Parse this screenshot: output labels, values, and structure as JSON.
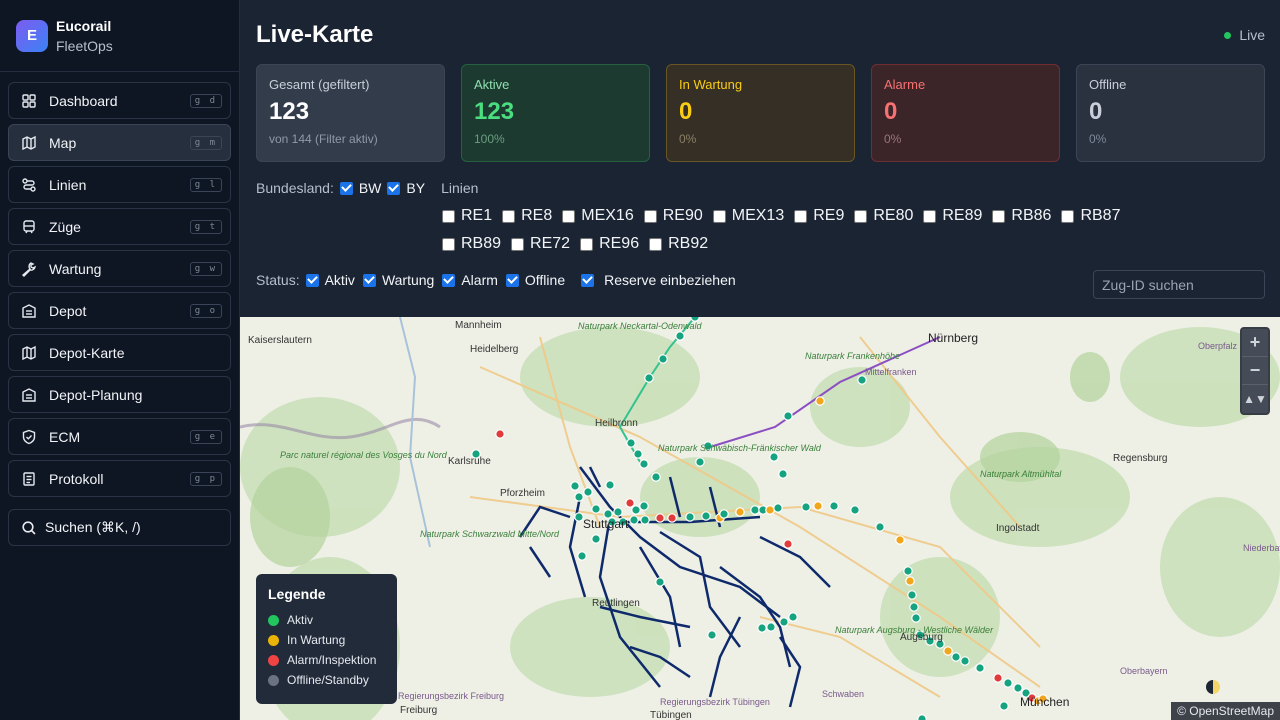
{
  "brand": {
    "initial": "E",
    "name": "Eucorail",
    "sub": "FleetOps"
  },
  "nav": [
    {
      "label": "Dashboard",
      "shortcut": "g d",
      "icon": "grid-icon",
      "active": false
    },
    {
      "label": "Map",
      "shortcut": "g m",
      "icon": "map-icon",
      "active": true
    },
    {
      "label": "Linien",
      "shortcut": "g l",
      "icon": "route-icon",
      "active": false
    },
    {
      "label": "Züge",
      "shortcut": "g t",
      "icon": "train-icon",
      "active": false
    },
    {
      "label": "Wartung",
      "shortcut": "g w",
      "icon": "wrench-icon",
      "active": false
    },
    {
      "label": "Depot",
      "shortcut": "g o",
      "icon": "building-icon",
      "active": false
    },
    {
      "label": "Depot-Karte",
      "shortcut": "",
      "icon": "map-icon",
      "active": false
    },
    {
      "label": "Depot-Planung",
      "shortcut": "",
      "icon": "building-icon",
      "active": false
    },
    {
      "label": "ECM",
      "shortcut": "g e",
      "icon": "shield-icon",
      "active": false
    },
    {
      "label": "Protokoll",
      "shortcut": "g p",
      "icon": "log-icon",
      "active": false
    }
  ],
  "search_nav": "Suchen (⌘K, /)",
  "header": {
    "title": "Live-Karte",
    "live_label": "Live"
  },
  "cards": {
    "total": {
      "label": "Gesamt (gefiltert)",
      "value": "123",
      "sub": "von 144 (Filter aktiv)"
    },
    "active": {
      "label": "Aktive",
      "value": "123",
      "sub": "100%"
    },
    "maintenance": {
      "label": "In Wartung",
      "value": "0",
      "sub": "0%"
    },
    "alarm": {
      "label": "Alarme",
      "value": "0",
      "sub": "0%"
    },
    "offline": {
      "label": "Offline",
      "value": "0",
      "sub": "0%"
    }
  },
  "filters": {
    "bundesland_label": "Bundesland:",
    "states": [
      {
        "label": "BW",
        "checked": true
      },
      {
        "label": "BY",
        "checked": true
      }
    ],
    "lines_label": "Linien",
    "lines": [
      "RE1",
      "RE8",
      "MEX16",
      "RE90",
      "MEX13",
      "RE9",
      "RE80",
      "RE89",
      "RB86",
      "RB87",
      "RB89",
      "RE72",
      "RE96",
      "RB92"
    ],
    "status_label": "Status:",
    "statuses": [
      {
        "label": "Aktiv",
        "checked": true
      },
      {
        "label": "Wartung",
        "checked": true
      },
      {
        "label": "Alarm",
        "checked": true
      },
      {
        "label": "Offline",
        "checked": true
      }
    ],
    "reserve_label": "Reserve einbeziehen",
    "reserve_checked": true,
    "train_search_placeholder": "Zug-ID suchen"
  },
  "map": {
    "cities": [
      "Mannheim",
      "Heidelberg",
      "Kaiserslautern",
      "Heilbronn",
      "Karlsruhe",
      "Pforzheim",
      "Stuttgart",
      "Reutlingen",
      "Nürnberg",
      "Regensburg",
      "Ingolstadt",
      "Augsburg",
      "München",
      "Freiburg",
      "Tübingen",
      "Schwaben",
      "Mittelfranken",
      "Oberpfalz",
      "Niederbayern",
      "Oberbayern"
    ],
    "parks": [
      "Naturpark Neckartal-Odenwald",
      "Naturpark Frankenhöhe",
      "Parc naturel régional des Vosges du Nord",
      "Naturpark Schwäbisch-Fränkischer Wald",
      "Naturpark Altmühltal",
      "Naturpark Schwarzwald Mitte/Nord",
      "Naturpark Augsburg - Westliche Wälder",
      "Regierungsbezirk Freiburg",
      "Regierungsbezirk Tübingen"
    ],
    "zoom_in": "+",
    "zoom_out": "−",
    "reset_north": "▲▼",
    "attribution": "© OpenStreetMap",
    "status_colors": {
      "active": "#16a37f",
      "maintenance": "#f2a61b",
      "alarm": "#e23b3b",
      "offline": "#6b7280"
    }
  },
  "legend": {
    "title": "Legende",
    "items": [
      {
        "label": "Aktiv",
        "color": "#22c55e"
      },
      {
        "label": "In Wartung",
        "color": "#eab308"
      },
      {
        "label": "Alarm/Inspektion",
        "color": "#ef4444"
      },
      {
        "label": "Offline/Standby",
        "color": "#6b7280"
      }
    ]
  }
}
